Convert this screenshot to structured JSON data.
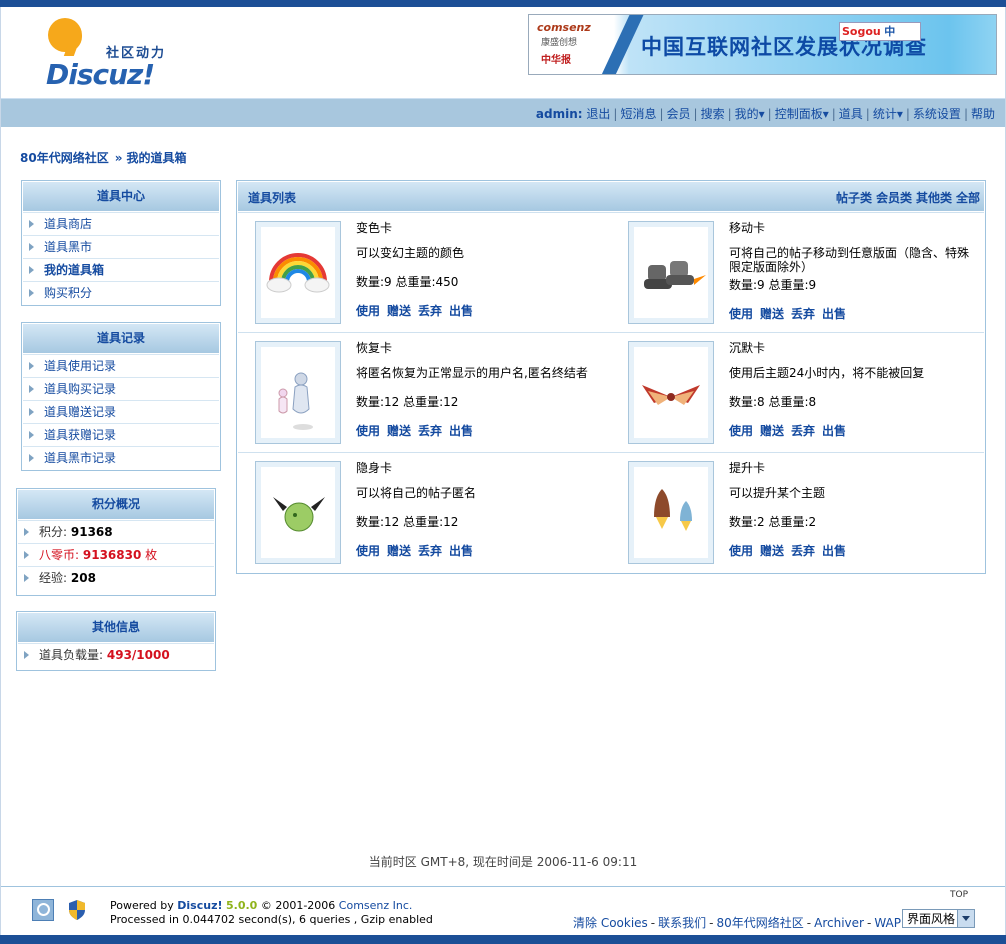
{
  "header": {
    "logo_slogan": "社区动力",
    "logo_brand": "Discuz!",
    "banner": {
      "company": "comsenz",
      "company_cn": "康盛创想",
      "partner": "中华报",
      "title": "中国互联网社区发展状况调查",
      "ime_logo": "Sogou",
      "ime_mode": "中"
    }
  },
  "nav": {
    "user": "admin:",
    "items": [
      "退出",
      "短消息",
      "会员",
      "搜索",
      "我的▾",
      "控制面板▾",
      "道具",
      "统计▾",
      "系统设置",
      "帮助"
    ]
  },
  "breadcrumb": {
    "home": "80年代网络社区",
    "sep": "»",
    "current": "我的道具箱"
  },
  "sidebar": {
    "tool_center": {
      "title": "道具中心",
      "items": [
        "道具商店",
        "道具黑市",
        "我的道具箱",
        "购买积分"
      ]
    },
    "tool_records": {
      "title": "道具记录",
      "items": [
        "道具使用记录",
        "道具购买记录",
        "道具赠送记录",
        "道具获赠记录",
        "道具黑市记录"
      ]
    },
    "points": {
      "title": "积分概况",
      "credit_label": "积分:",
      "credit_value": "91368",
      "coins_label": "八零币:",
      "coins_value": "9136830",
      "coins_unit": "枚",
      "exp_label": "经验:",
      "exp_value": "208"
    },
    "other": {
      "title": "其他信息",
      "load_label": "道具负载量:",
      "load_value": "493/1000"
    }
  },
  "main": {
    "title": "道具列表",
    "categories": [
      "帖子类",
      "会员类",
      "其他类",
      "全部"
    ],
    "tools": [
      {
        "name": "变色卡",
        "desc": "可以变幻主题的颜色",
        "qty": "数量:9 总重量:450",
        "icon": "rainbow-icon"
      },
      {
        "name": "移动卡",
        "desc": "可将自己的帖子移动到任意版面（隐含、特殊限定版面除外）",
        "qty": "数量:9 总重量:9",
        "icon": "rocket-boots-icon"
      },
      {
        "name": "恢复卡",
        "desc": "将匿名恢复为正常显示的用户名,匿名终结者",
        "qty": "数量:12 总重量:12",
        "icon": "ghost-figure-icon"
      },
      {
        "name": "沉默卡",
        "desc": "使用后主题24小时内，将不能被回复",
        "qty": "数量:8 总重量:8",
        "icon": "winged-badge-icon"
      },
      {
        "name": "隐身卡",
        "desc": "可以将自己的帖子匿名",
        "qty": "数量:12 总重量:12",
        "icon": "winged-ball-icon"
      },
      {
        "name": "提升卡",
        "desc": "可以提升某个主题",
        "qty": "数量:2 总重量:2",
        "icon": "rockets-icon"
      }
    ],
    "actions": [
      "使用",
      "赠送",
      "丢弃",
      "出售"
    ]
  },
  "footer": {
    "time": "当前时区 GMT+8, 现在时间是 2006-11-6 09:11",
    "powered_prefix": "Powered by ",
    "powered_brand": "Discuz!",
    "powered_version": "5.0.0",
    "copyright": "© 2001-2006",
    "company": "Comsenz Inc.",
    "processed": "Processed in 0.044702 second(s), 6 queries , Gzip enabled",
    "links": [
      "清除 Cookies",
      "联系我们",
      "80年代网络社区",
      "Archiver",
      "WAP"
    ],
    "top": "TOP",
    "style_select": "界面风格"
  },
  "colors": {
    "brand_blue": "#1c4f96",
    "link": "#154ba0",
    "header_bg": "#a8c7de",
    "alert_red": "#d4111f"
  }
}
